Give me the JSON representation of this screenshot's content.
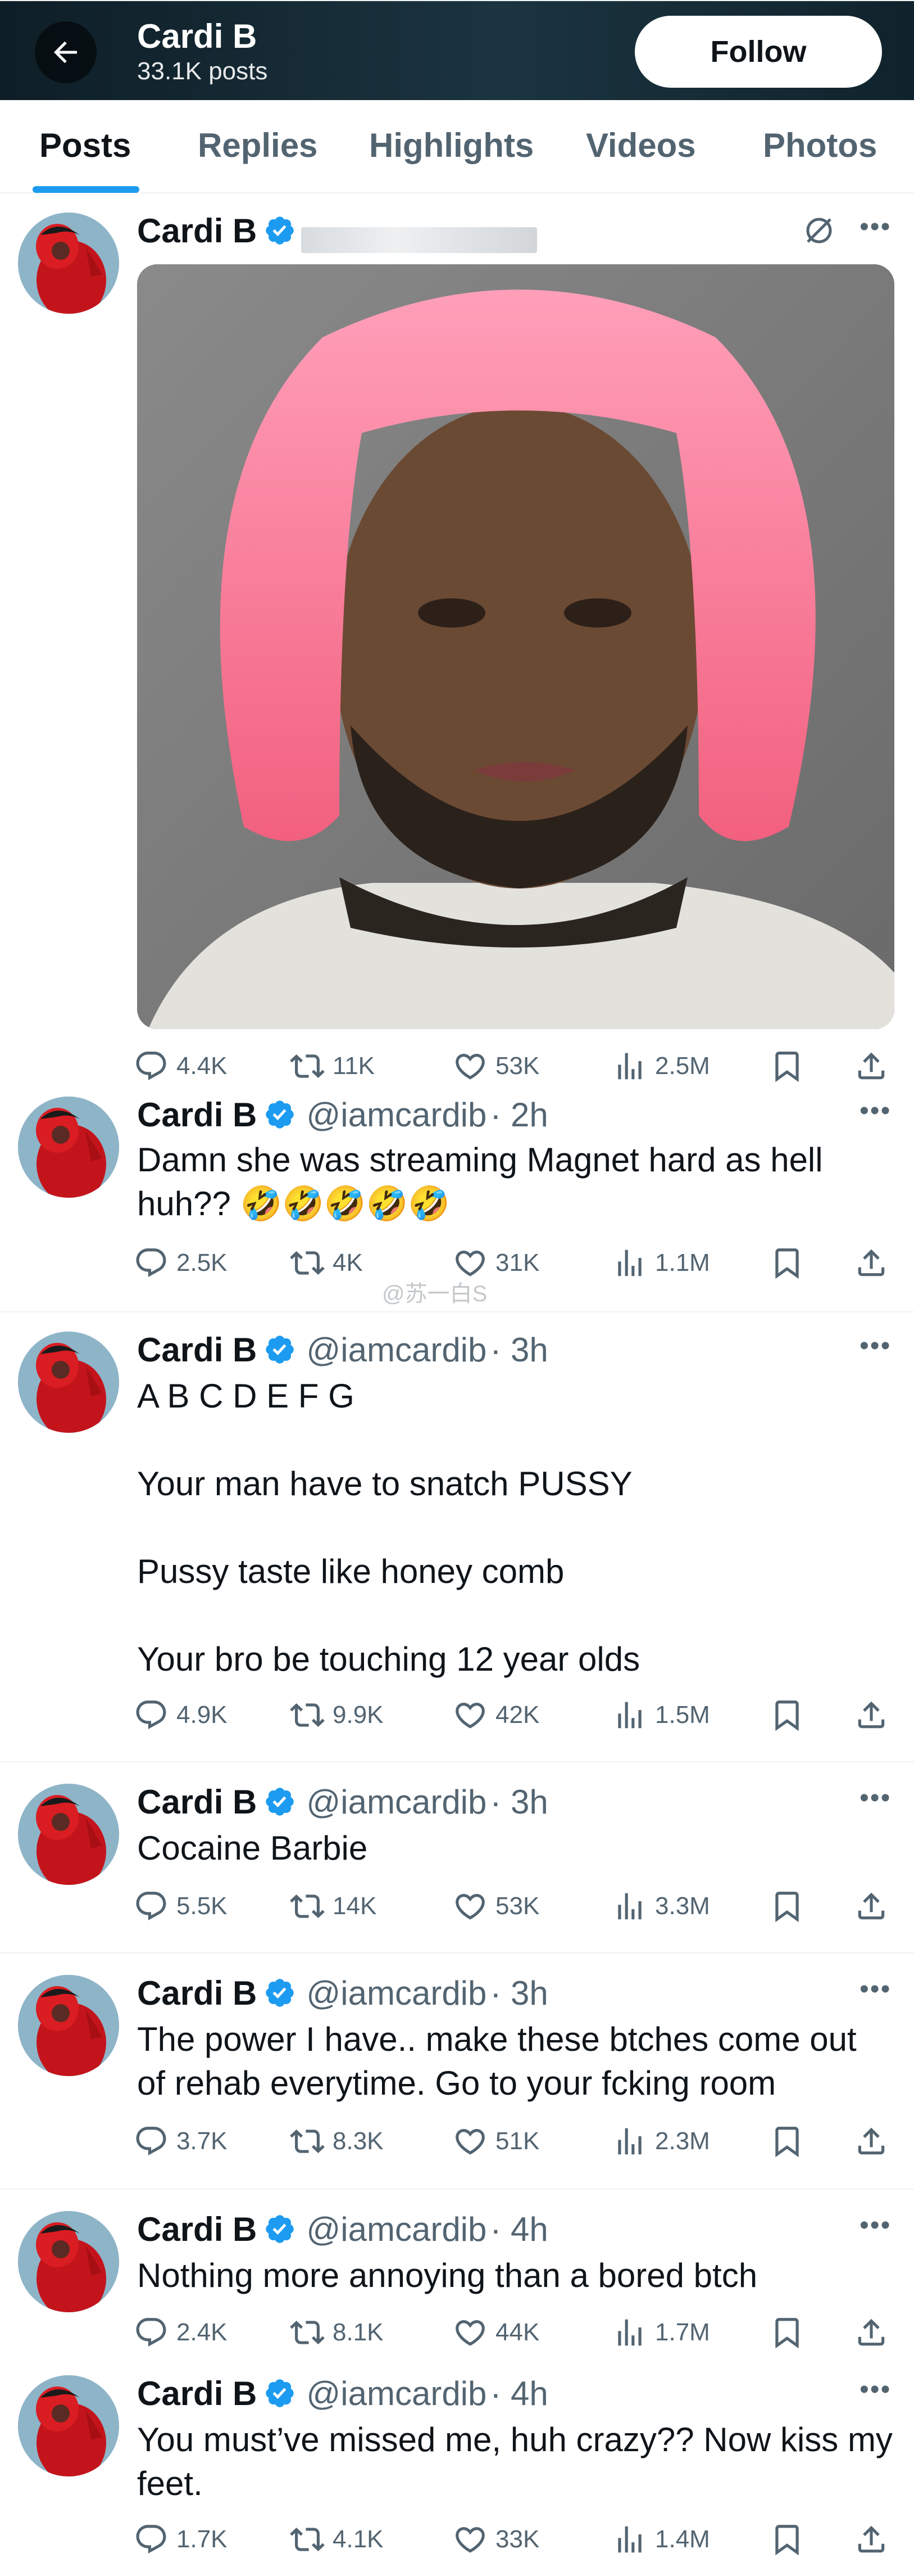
{
  "header": {
    "name": "Cardi B",
    "posts_count": "33.1K posts",
    "follow_label": "Follow"
  },
  "tabs": [
    {
      "label": "Posts",
      "active": true
    },
    {
      "label": "Replies",
      "active": false
    },
    {
      "label": "Highlights",
      "active": false
    },
    {
      "label": "Videos",
      "active": false
    },
    {
      "label": "Photos",
      "active": false
    }
  ],
  "colors": {
    "accent": "#1d9bf0",
    "text": "#0f1419",
    "muted": "#536471"
  },
  "icons": [
    "back-arrow-icon",
    "verified-badge-icon",
    "more-icon",
    "grok-icon",
    "reply-icon",
    "repost-icon",
    "like-icon",
    "views-icon",
    "bookmark-icon",
    "share-icon"
  ],
  "watermark": "@苏一白S",
  "tweets": [
    {
      "name": "Cardi B",
      "handle": "",
      "time": "",
      "has_media": true,
      "text": [],
      "stats": {
        "replies": "4.4K",
        "reposts": "11K",
        "likes": "53K",
        "views": "2.5M"
      }
    },
    {
      "name": "Cardi B",
      "handle": "@iamcardib",
      "time": "· 2h",
      "text": [
        "Damn she was streaming Magnet hard as hell",
        "huh?? 🤣🤣🤣🤣🤣"
      ],
      "stats": {
        "replies": "2.5K",
        "reposts": "4K",
        "likes": "31K",
        "views": "1.1M"
      }
    },
    {
      "name": "Cardi B",
      "handle": "@iamcardib",
      "time": "· 3h",
      "text": [
        "A B C D E F G",
        "",
        "Your man have to snatch PUSSY",
        "",
        "Pussy taste like honey comb",
        "",
        "Your bro be touching 12 year olds"
      ],
      "stats": {
        "replies": "4.9K",
        "reposts": "9.9K",
        "likes": "42K",
        "views": "1.5M"
      }
    },
    {
      "name": "Cardi B",
      "handle": "@iamcardib",
      "time": "· 3h",
      "text": [
        "Cocaine Barbie"
      ],
      "stats": {
        "replies": "5.5K",
        "reposts": "14K",
        "likes": "53K",
        "views": "3.3M"
      }
    },
    {
      "name": "Cardi B",
      "handle": "@iamcardib",
      "time": "· 3h",
      "text": [
        "The power I have.. make these btches come out",
        "of rehab everytime. Go to your fcking room"
      ],
      "stats": {
        "replies": "3.7K",
        "reposts": "8.3K",
        "likes": "51K",
        "views": "2.3M"
      }
    },
    {
      "name": "Cardi B",
      "handle": "@iamcardib",
      "time": "· 4h",
      "text": [
        "Nothing more annoying than a bored btch"
      ],
      "stats": {
        "replies": "2.4K",
        "reposts": "8.1K",
        "likes": "44K",
        "views": "1.7M"
      }
    },
    {
      "name": "Cardi B",
      "handle": "@iamcardib",
      "time": "· 4h",
      "text": [
        "You must’ve missed me, huh crazy?? Now kiss my",
        "feet."
      ],
      "stats": {
        "replies": "1.7K",
        "reposts": "4.1K",
        "likes": "33K",
        "views": "1.4M"
      }
    }
  ]
}
